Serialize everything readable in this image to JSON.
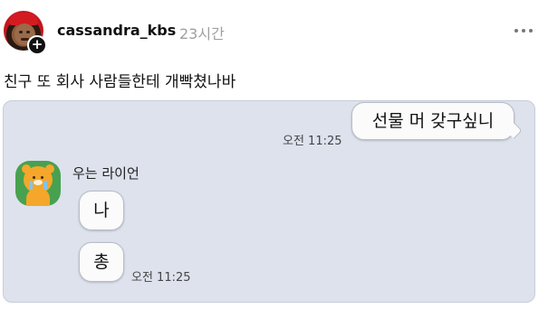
{
  "post": {
    "username": "cassandra_kbs",
    "time": "23시간",
    "text": "친구 또 회사 사람들한테 개빡쳤나바",
    "plus_glyph": "+"
  },
  "chat": {
    "me_message": {
      "text": "선물 머 갖구싶니",
      "time": "오전 11:25"
    },
    "friend": {
      "name": "우는 라이언",
      "messages": [
        {
          "text": "나"
        },
        {
          "text": "총",
          "time": "오전 11:25"
        }
      ]
    },
    "background_color": "#dde2ed"
  },
  "icons": {
    "more": "more-horizontal-icon",
    "follow": "plus-icon",
    "friend_avatar": "crying-lion-icon"
  }
}
